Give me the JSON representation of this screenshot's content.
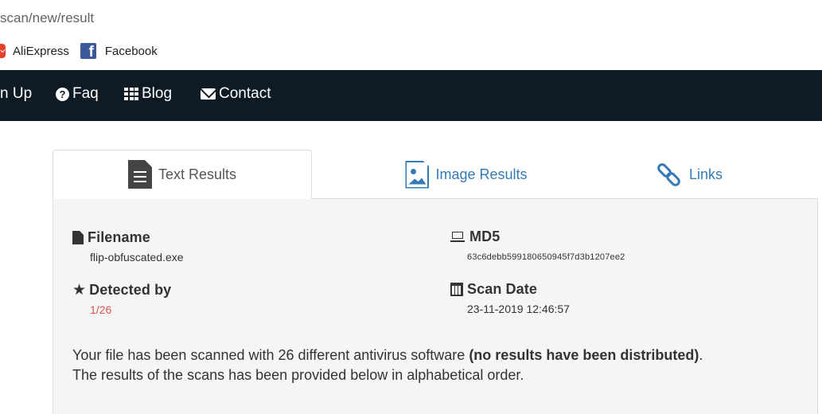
{
  "browser": {
    "url": "scan/new/result",
    "bookmarks": [
      {
        "label": "AliExpress",
        "icon": "aliexpress-icon"
      },
      {
        "label": "Facebook",
        "icon": "facebook-icon"
      }
    ]
  },
  "nav": {
    "signup_partial": "n Up",
    "faq": "Faq",
    "blog": "Blog",
    "contact": "Contact",
    "background": "#0e1a24"
  },
  "tabs": {
    "text_results": "Text Results",
    "image_results": "Image Results",
    "links": "Links",
    "active": "Text Results",
    "link_color": "#337ab7"
  },
  "result": {
    "filename_label": "Filename",
    "filename": "flip-obfuscated.exe",
    "md5_label": "MD5",
    "md5": "63c6debb599180650945f7d3b1207ee2",
    "detected_label": "Detected by",
    "detected": "1/26",
    "scan_date_label": "Scan Date",
    "scan_date": "23-11-2019 12:46:57",
    "desc_part1": "Your file has been scanned with 26 different antivirus software ",
    "desc_bold": "(no results have been distributed)",
    "desc_part2": ".",
    "desc_line2": "The results of the scans has been provided below in alphabetical order."
  }
}
